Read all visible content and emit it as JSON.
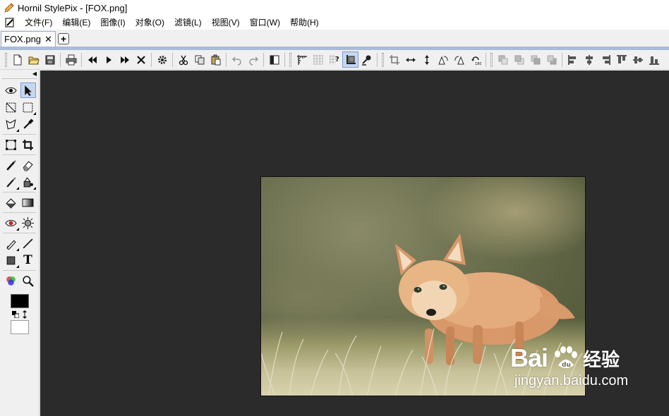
{
  "window": {
    "title": "Hornil StylePix - [FOX.png]"
  },
  "menu": {
    "items": [
      "文件(F)",
      "编辑(E)",
      "图像(I)",
      "对象(O)",
      "滤镜(L)",
      "视图(V)",
      "窗口(W)",
      "帮助(H)"
    ]
  },
  "tabs": {
    "active_label": "FOX.png",
    "close_glyph": "✕",
    "add_glyph": "+"
  },
  "toolbar": {
    "groups": [
      [
        "new-icon",
        "open-icon",
        "save-icon"
      ],
      [
        "print-icon"
      ],
      [
        "first-icon",
        "play-icon",
        "fast-forward-icon",
        "close-icon"
      ],
      [
        "batch-gear-icon"
      ],
      [
        "cut-icon",
        "copy-icon",
        "paste-icon"
      ],
      [
        "undo-icon",
        "redo-icon"
      ],
      [
        "panel-toggle-icon"
      ],
      [
        "ruler-icon",
        "grid-icon",
        "snap-icon",
        "guide-icon",
        "pin-icon"
      ],
      [
        "crop-icon",
        "flip-horizontal-icon",
        "flip-vertical-icon",
        "rotate-left-icon",
        "rotate-right-icon",
        "rotate-180-icon"
      ],
      [
        "arrange-front-icon",
        "arrange-forward-icon",
        "arrange-backward-icon",
        "arrange-back-icon"
      ],
      [
        "align-left-icon",
        "align-center-icon",
        "align-right-icon",
        "align-top-icon",
        "align-middle-icon",
        "align-bottom-icon"
      ]
    ],
    "active_button": "guide-icon"
  },
  "tools": {
    "rows": [
      [
        "eye-view-icon",
        "pointer-icon"
      ],
      [
        "free-select-icon",
        "rect-select-icon"
      ],
      [
        "lasso-icon",
        "eyedropper-icon"
      ],
      [
        "transform-icon",
        "crop-tool-icon"
      ],
      [
        "brush-icon",
        "eraser-icon"
      ],
      [
        "clone-stamp-icon",
        "fill-bucket-icon"
      ],
      [
        "paint-bucket-icon",
        "gradient-icon"
      ],
      [
        "red-eye-icon",
        "brightness-icon"
      ],
      [
        "pen-icon",
        "line-icon"
      ],
      [
        "shape-icon",
        "text-icon"
      ],
      [
        "color-balance-icon",
        "zoom-icon"
      ]
    ],
    "active_tool": "pointer-icon",
    "foreground_color": "#000000",
    "background_color": "#ffffff",
    "text_tool_glyph": "T"
  },
  "workspace": {
    "background": "#2b2b2b",
    "image_name": "FOX.png"
  },
  "watermark": {
    "logo_text_1": "Bai",
    "logo_text_2": "",
    "chinese": "经验",
    "url": "jingyan.baidu.com"
  }
}
